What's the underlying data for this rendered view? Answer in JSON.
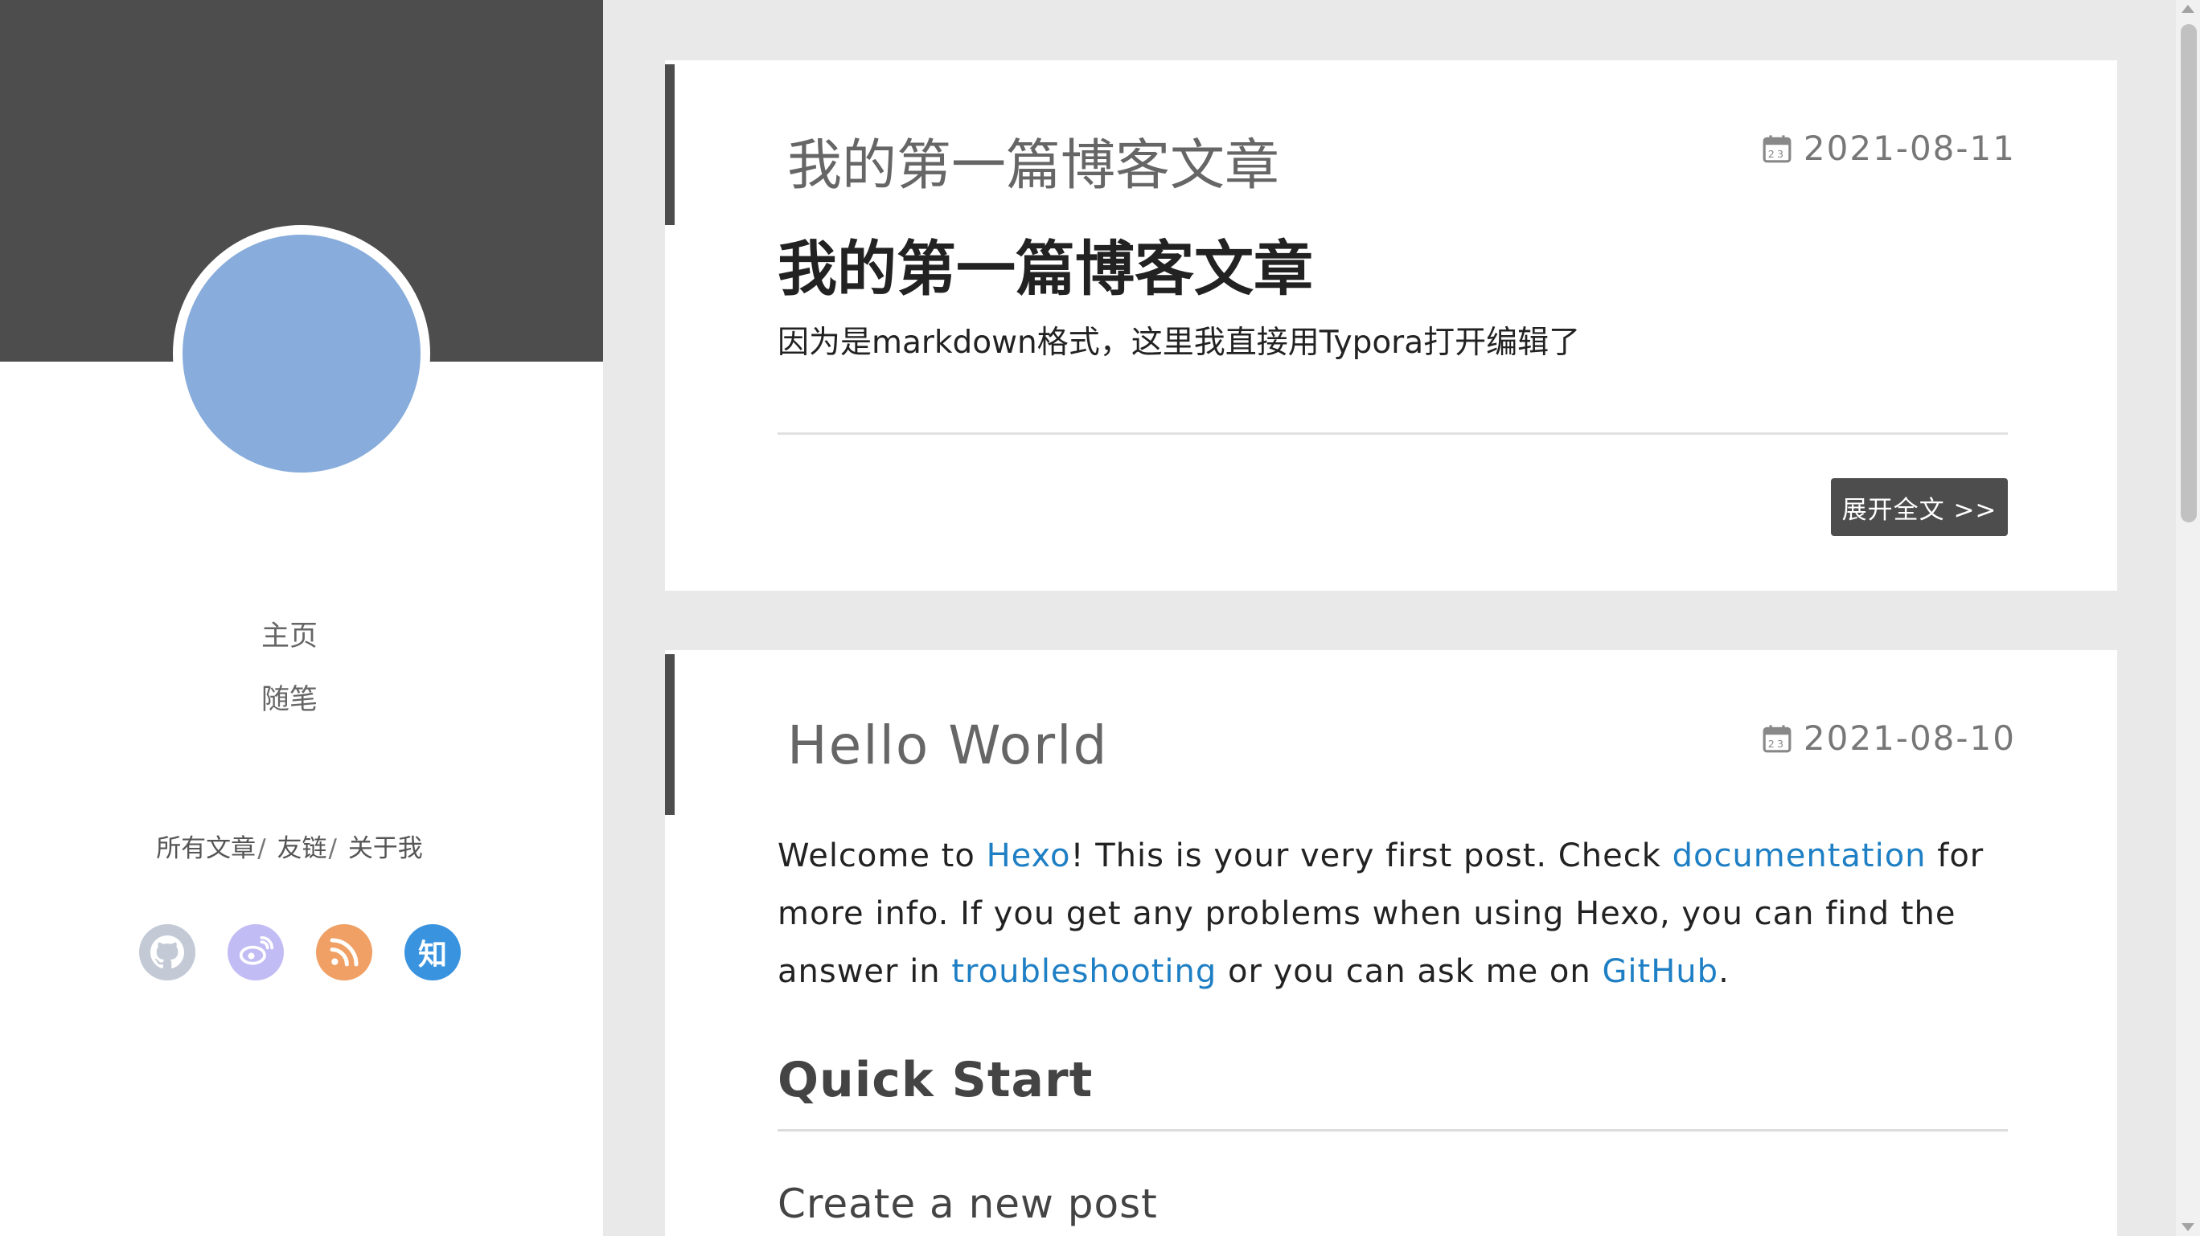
{
  "sidebar": {
    "nav": [
      "主页",
      "随笔"
    ],
    "links": [
      "所有文章",
      "友链",
      "关于我"
    ],
    "social": [
      {
        "icon": "github-icon",
        "label": ""
      },
      {
        "icon": "weibo-icon",
        "label": ""
      },
      {
        "icon": "rss-icon",
        "label": ""
      },
      {
        "icon": "zhihu-icon",
        "label": "知"
      }
    ]
  },
  "posts": [
    {
      "title": "我的第一篇博客文章",
      "date": "2021-08-11",
      "heading": "我的第一篇博客文章",
      "excerpt": "因为是markdown格式，这里我直接用Typora打开编辑了",
      "more_label": "展开全文 >>"
    },
    {
      "title": "Hello World",
      "date": "2021-08-10",
      "body": {
        "t1": "Welcome to ",
        "link_hexo": "Hexo",
        "t2": "! This is your very first post. Check ",
        "link_docs": "documentation",
        "t3": " for more info. If you get any problems when using Hexo, you can find the answer in ",
        "link_trouble": "troubleshooting",
        "t4": " or you can ask me on ",
        "link_github": "GitHub",
        "t5": "."
      },
      "h2": "Quick Start",
      "h3": "Create a new post"
    }
  ],
  "colors": {
    "accent": "#4d4d4d",
    "link": "#1e7fc4",
    "avatar": "#88acdb"
  }
}
